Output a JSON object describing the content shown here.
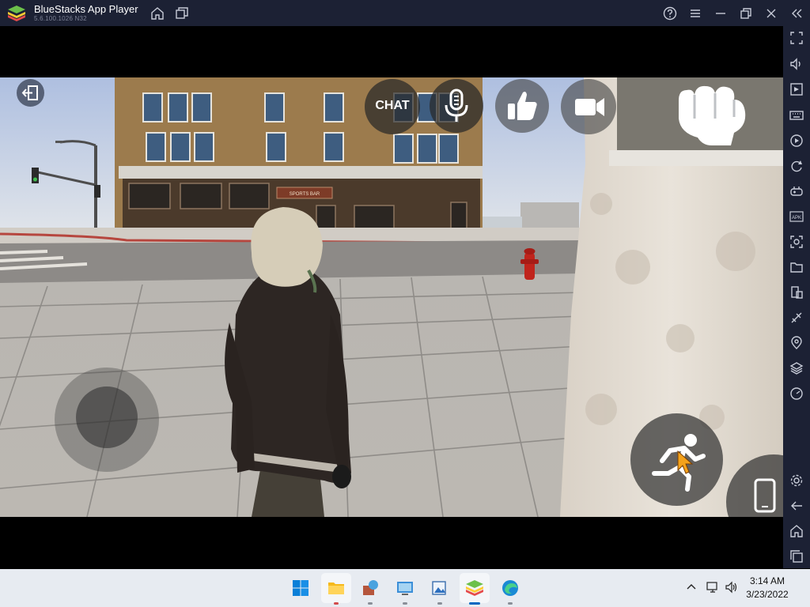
{
  "window": {
    "title": "BlueStacks App Player",
    "version": "5.6.100.1026 N32"
  },
  "titlebar_icons": [
    "home-icon",
    "multi-instance-icon",
    "help-icon",
    "menu-icon",
    "minimize-icon",
    "restore-icon",
    "close-icon",
    "collapse-sidebar-icon"
  ],
  "sidebar_icons": [
    "fullscreen-icon",
    "volume-icon",
    "screen-cast-icon",
    "keyboard-controls-icon",
    "macro-recorder-icon",
    "rotate-icon",
    "gamepad-icon",
    "install-apk-icon",
    "screenshot-icon",
    "folder-icon",
    "multi-window-icon",
    "eco-mode-icon",
    "location-icon",
    "layers-icon",
    "speed-icon",
    "settings-icon",
    "back-icon",
    "home-icon",
    "recent-apps-icon"
  ],
  "game": {
    "chat_label": "CHAT",
    "store_sign": "SPORTS BAR",
    "colors": {
      "sky": "#cfd9e8",
      "building": "#9c7b4d",
      "pavement": "#c3c0ba",
      "hoodie": "#d6cdb8",
      "jacket": "#2d2623",
      "hydrant": "#c0241c"
    }
  },
  "taskbar": {
    "apps": [
      "start-icon",
      "file-explorer-icon",
      "app-icon",
      "control-panel-icon",
      "photos-icon",
      "bluestacks-icon",
      "edge-icon"
    ],
    "time": "3:14 AM",
    "date": "3/23/2022"
  }
}
